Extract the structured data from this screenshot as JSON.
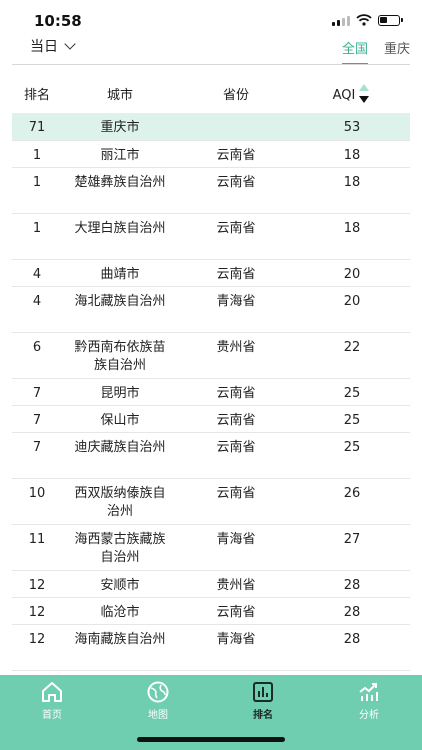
{
  "status": {
    "time": "10:58"
  },
  "header": {
    "period": "当日",
    "scope_tabs": [
      {
        "label": "全国",
        "active": true
      },
      {
        "label": "重庆",
        "active": false
      }
    ]
  },
  "table": {
    "columns": {
      "rank": "排名",
      "city": "城市",
      "province": "省份",
      "aqi": "AQI"
    },
    "rows": [
      {
        "rank": "71",
        "city": "重庆市",
        "province": "",
        "aqi": "53"
      },
      {
        "rank": "1",
        "city": "丽江市",
        "province": "云南省",
        "aqi": "18"
      },
      {
        "rank": "1",
        "city": "楚雄彝族自治州",
        "province": "云南省",
        "aqi": "18"
      },
      {
        "rank": "1",
        "city": "大理白族自治州",
        "province": "云南省",
        "aqi": "18"
      },
      {
        "rank": "4",
        "city": "曲靖市",
        "province": "云南省",
        "aqi": "20"
      },
      {
        "rank": "4",
        "city": "海北藏族自治州",
        "province": "青海省",
        "aqi": "20"
      },
      {
        "rank": "6",
        "city": "黔西南布依族苗族自治州",
        "province": "贵州省",
        "aqi": "22"
      },
      {
        "rank": "7",
        "city": "昆明市",
        "province": "云南省",
        "aqi": "25"
      },
      {
        "rank": "7",
        "city": "保山市",
        "province": "云南省",
        "aqi": "25"
      },
      {
        "rank": "7",
        "city": "迪庆藏族自治州",
        "province": "云南省",
        "aqi": "25"
      },
      {
        "rank": "10",
        "city": "西双版纳傣族自治州",
        "province": "云南省",
        "aqi": "26"
      },
      {
        "rank": "11",
        "city": "海西蒙古族藏族自治州",
        "province": "青海省",
        "aqi": "27"
      },
      {
        "rank": "12",
        "city": "安顺市",
        "province": "贵州省",
        "aqi": "28"
      },
      {
        "rank": "12",
        "city": "临沧市",
        "province": "云南省",
        "aqi": "28"
      },
      {
        "rank": "12",
        "city": "海南藏族自治州",
        "province": "青海省",
        "aqi": "28"
      }
    ]
  },
  "tabbar": {
    "home": "首页",
    "map": "地图",
    "rank": "排名",
    "analysis": "分析"
  },
  "colors": {
    "accent": "#3aaf8f",
    "tabbar": "#6fcdb0",
    "highlight_row": "#ddf2eb"
  }
}
